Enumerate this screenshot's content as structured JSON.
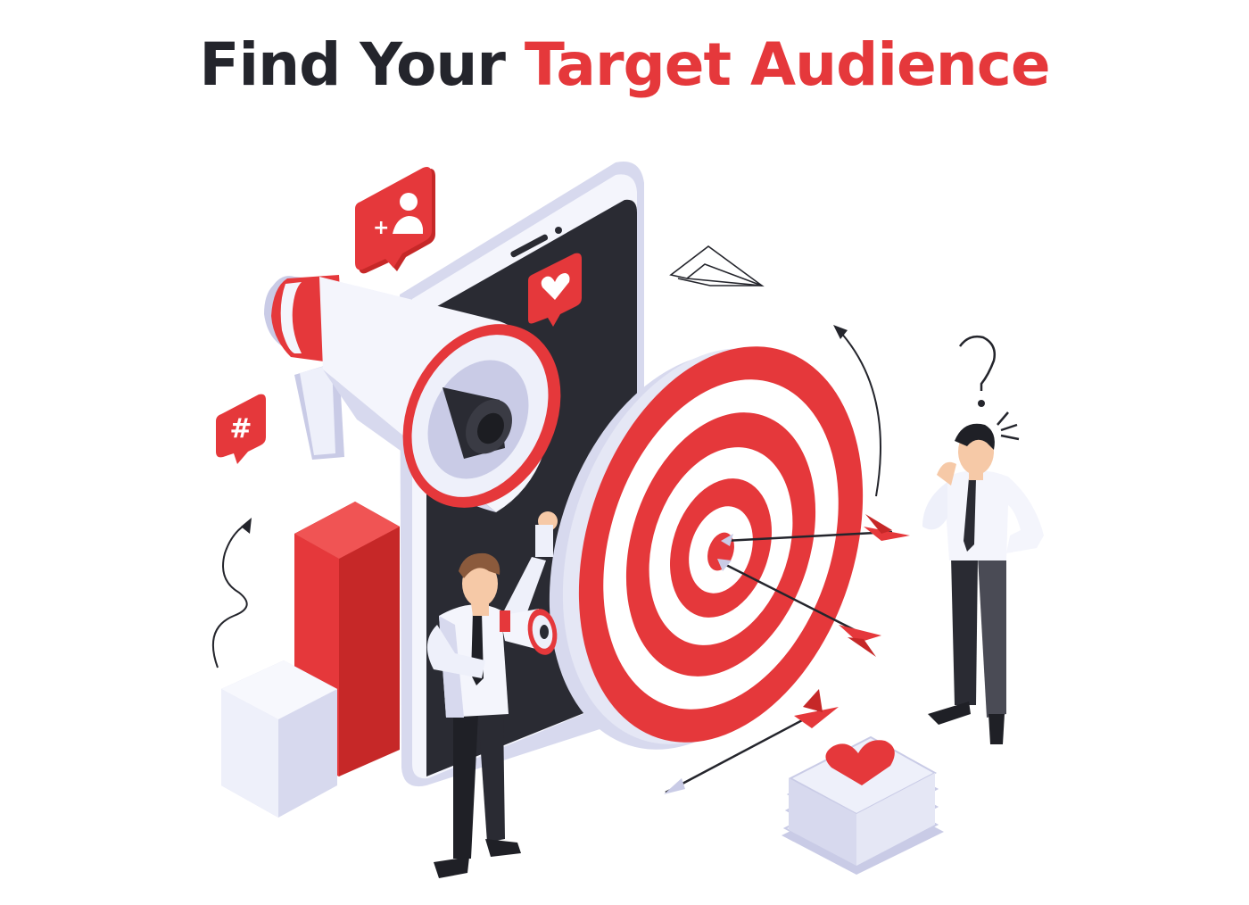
{
  "title": {
    "part1": "Find Your",
    "part2": "Target Audience"
  },
  "colors": {
    "dark": "#24252c",
    "accent": "#e5383b",
    "light": "#eef0fa",
    "shade": "#c9cbe6"
  },
  "icons": {
    "hashtag_glyph": "#",
    "add_user_glyph": "+"
  }
}
